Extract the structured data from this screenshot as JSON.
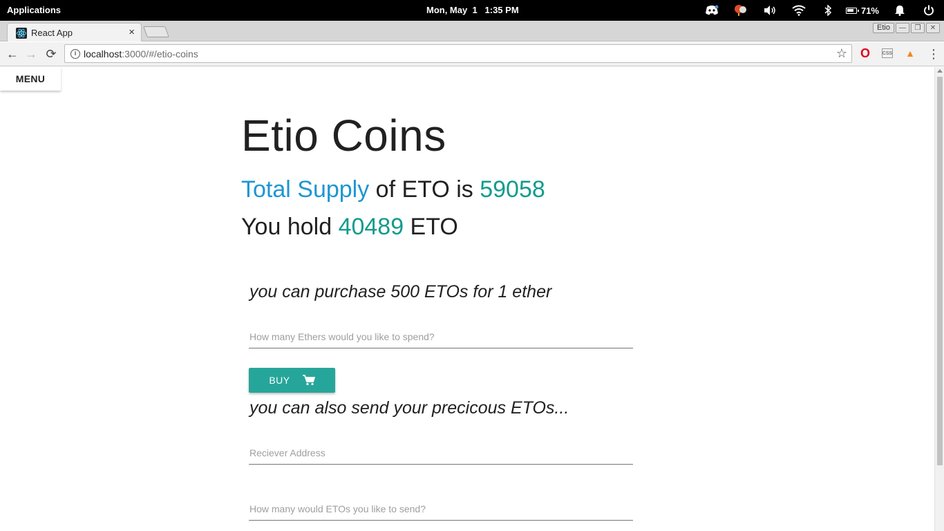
{
  "os": {
    "apps_label": "Applications",
    "clock": "Mon, May  1   1:35 PM",
    "battery_pct": "71%",
    "tray_icons": [
      "discord-icon",
      "notification-balloon-icon",
      "volume-icon",
      "wifi-icon",
      "bluetooth-icon",
      "battery-icon",
      "bell-icon",
      "power-icon"
    ]
  },
  "browser": {
    "tab_title": "React App",
    "tab_close": "×",
    "profile_label": "Etio",
    "url_host": "localhost",
    "url_rest": ":3000/#/etio-coins",
    "nav": {
      "back": "←",
      "forward": "→",
      "reload": "⟳"
    }
  },
  "page": {
    "menu_label": "MENU",
    "title": "Etio Coins",
    "supply": {
      "label": "Total Supply",
      "mid": " of ETO is ",
      "value": "59058"
    },
    "hold": {
      "prefix": "You hold ",
      "value": "40489",
      "suffix": " ETO"
    },
    "purchase_heading": "you can purchase 500 ETOs for 1 ether",
    "ethers_placeholder": "How many Ethers would you like to spend?",
    "buy_label": "BUY",
    "send_heading": "you can also send your precicous ETOs...",
    "receiver_placeholder": "Reciever Address",
    "amount_placeholder": "How many would ETOs you like to send?"
  },
  "colors": {
    "accent_blue": "#1e96d2",
    "accent_teal": "#139b8d",
    "button_teal": "#26a69a"
  }
}
